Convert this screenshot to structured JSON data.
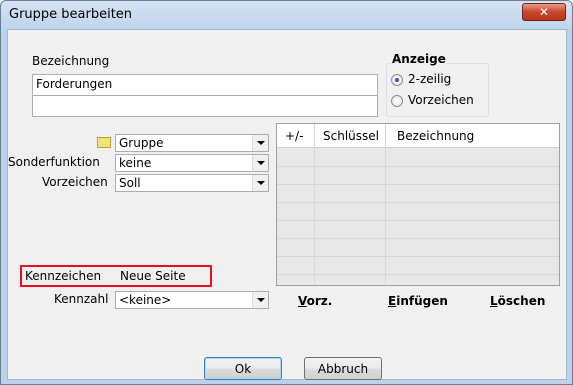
{
  "window": {
    "title": "Gruppe bearbeiten",
    "close_glyph": "✕"
  },
  "bezeichnung": {
    "label": "Bezeichnung",
    "line1": "Forderungen",
    "line2": ""
  },
  "anzeige": {
    "title": "Anzeige",
    "options": [
      {
        "label": "2-zeilig",
        "checked": true
      },
      {
        "label": "Vorzeichen",
        "checked": false
      }
    ]
  },
  "gruppe_combo": {
    "value": "Gruppe",
    "icon": "folder-icon"
  },
  "sonderfunktion": {
    "label": "Sonderfunktion",
    "value": "keine"
  },
  "vorzeichen": {
    "label": "Vorzeichen",
    "value": "Soll"
  },
  "kennzeichen": {
    "label": "Kennzeichen",
    "value": "Neue Seite",
    "highlight_color": "#e8101a"
  },
  "kennzahl": {
    "label": "Kennzahl",
    "value": "<keine>"
  },
  "grid": {
    "columns": [
      "+/-",
      "Schlüssel",
      "Bezeichnung"
    ]
  },
  "grid_actions": {
    "vorz": {
      "u": "V",
      "rest": "orz."
    },
    "einfuegen": {
      "u": "E",
      "rest": "infügen"
    },
    "loeschen": {
      "u": "L",
      "rest": "öschen"
    }
  },
  "buttons": {
    "ok": "Ok",
    "cancel": "Abbruch"
  }
}
